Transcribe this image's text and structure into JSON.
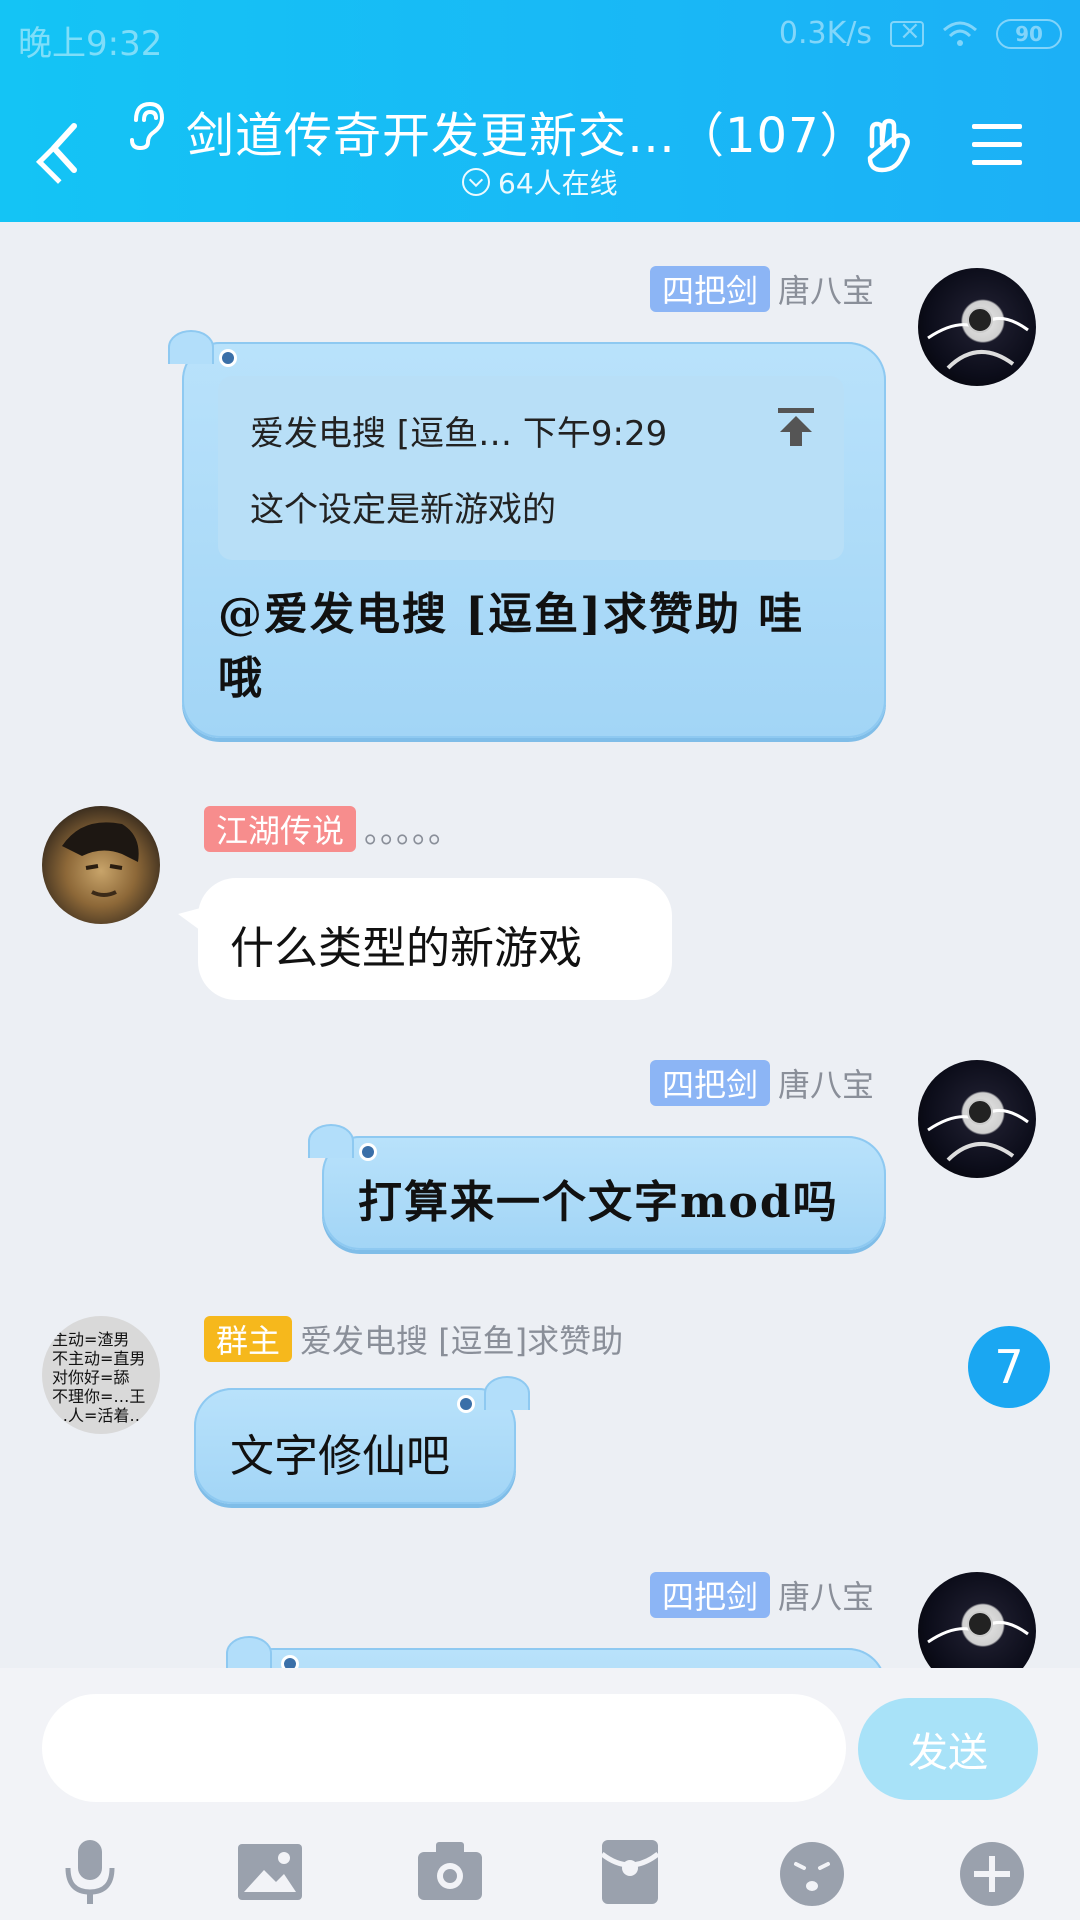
{
  "status_bar": {
    "time": "晚上9:32",
    "speed": "0.3K/s",
    "battery": "90"
  },
  "header": {
    "title": "剑道传奇开发更新交…（107）",
    "online": "64人在线"
  },
  "messages": [
    {
      "badge": "四把剑",
      "sender": "唐八宝",
      "quote_line1": "爱发电搜 [逗鱼… 下午9:29",
      "quote_line2": "这个设定是新游戏的",
      "text_line1": "@爱发电搜 [逗鱼]求赞助 哇",
      "text_line2": "哦"
    },
    {
      "badge": "江湖传说",
      "sender": "。。。。。",
      "text": "什么类型的新游戏"
    },
    {
      "badge": "四把剑",
      "sender": "唐八宝",
      "text": "打算来一个文字mod吗"
    },
    {
      "badge": "群主",
      "sender": "爱发电搜 [逗鱼]求赞助",
      "text": "文字修仙吧",
      "avatar_lines": [
        "主动=渣男",
        "不主动=直男",
        "对你好=舔",
        "不理你=…王",
        "…人=活着…"
      ]
    },
    {
      "badge": "四把剑",
      "sender": "唐八宝"
    }
  ],
  "unread_count": "7",
  "input": {
    "placeholder": "",
    "send_label": "发送"
  },
  "toolbar": [
    "microphone-icon",
    "image-icon",
    "camera-icon",
    "red-packet-icon",
    "emoji-icon",
    "plus-icon"
  ],
  "colors": {
    "header": "#14c4f5",
    "bubble": "#a2d5f6",
    "send": "#a8e2f8"
  }
}
